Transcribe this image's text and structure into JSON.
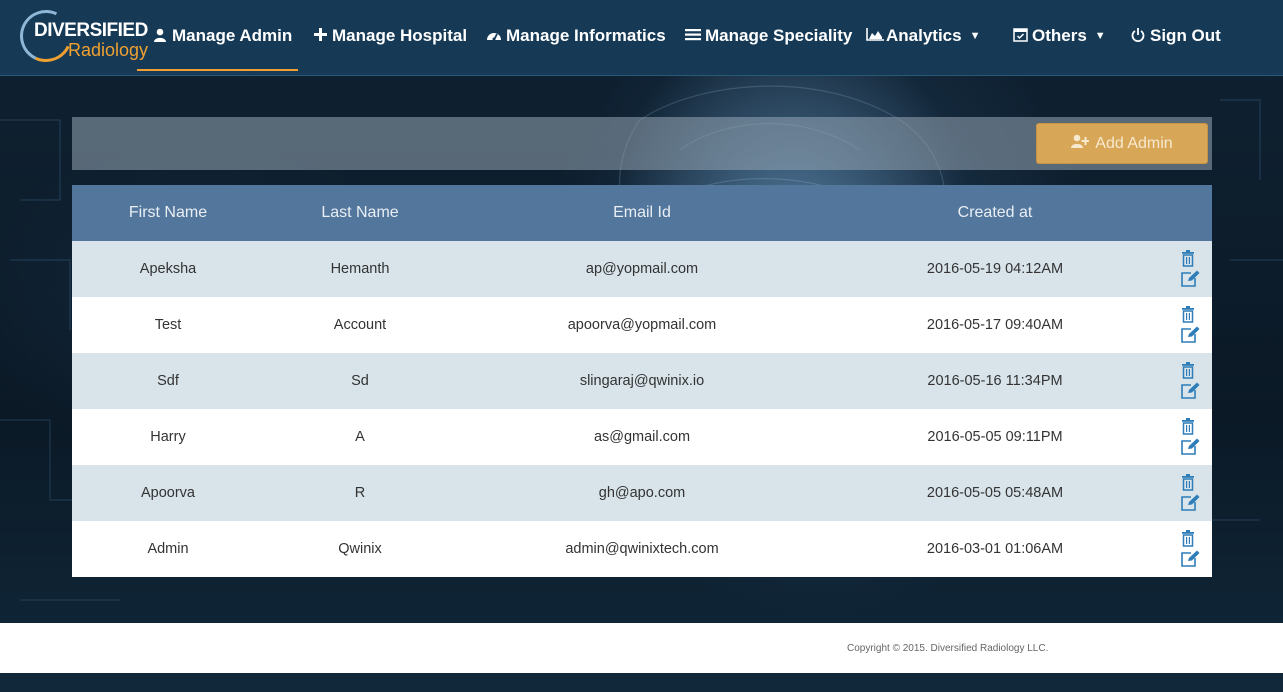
{
  "logo": {
    "line1": "DIVERSIFIED",
    "line2": "Radiology"
  },
  "nav": {
    "items": [
      {
        "label": "Manage Admin",
        "icon": "user-icon"
      },
      {
        "label": "Manage Hospital",
        "icon": "plus-icon"
      },
      {
        "label": "Manage Informatics",
        "icon": "dashboard-icon"
      },
      {
        "label": "Manage Speciality",
        "icon": "list-icon"
      },
      {
        "label": "Analytics",
        "icon": "area-chart-icon"
      },
      {
        "label": "Others",
        "icon": "calendar-check-icon"
      },
      {
        "label": "Sign Out",
        "icon": "power-icon"
      }
    ],
    "active": "Manage Admin"
  },
  "toolbar": {
    "add_label": "Add Admin",
    "add_icon": "user-plus-icon"
  },
  "table": {
    "headers": [
      "First Name",
      "Last Name",
      "Email Id",
      "Created at"
    ],
    "rows": [
      {
        "first": "Apeksha",
        "last": "Hemanth",
        "email": "ap@yopmail.com",
        "created": "2016-05-19 04:12AM"
      },
      {
        "first": "Test",
        "last": "Account",
        "email": "apoorva@yopmail.com",
        "created": "2016-05-17 09:40AM"
      },
      {
        "first": "Sdf",
        "last": "Sd",
        "email": "slingaraj@qwinix.io",
        "created": "2016-05-16 11:34PM"
      },
      {
        "first": "Harry",
        "last": "A",
        "email": "as@gmail.com",
        "created": "2016-05-05 09:11PM"
      },
      {
        "first": "Apoorva",
        "last": "R",
        "email": "gh@apo.com",
        "created": "2016-05-05 05:48AM"
      },
      {
        "first": "Admin",
        "last": "Qwinix",
        "email": "admin@qwinixtech.com",
        "created": "2016-03-01 01:06AM"
      }
    ]
  },
  "footer": {
    "copyright": "Copyright © 2015. Diversified Radiology LLC."
  },
  "colors": {
    "navbar": "#163a56",
    "accent": "#f0a030",
    "table_header": "#53779c",
    "row_alt": "#d8e3ea",
    "add_button": "#d8a657",
    "action_icon": "#2e7db8"
  }
}
